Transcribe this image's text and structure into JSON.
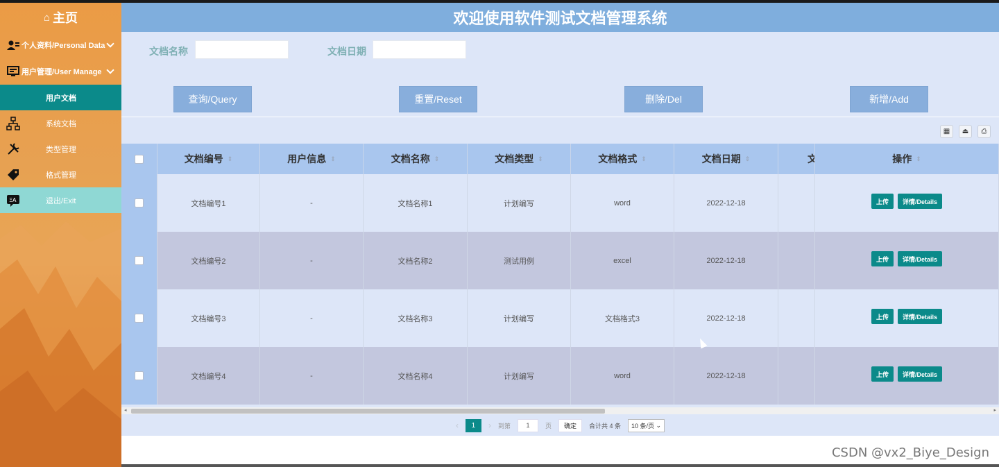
{
  "window": {
    "title": "欢迎使用软件测试文档管理系统"
  },
  "sidebar": {
    "home": "主页",
    "groups": [
      {
        "label": "个人资料/Personal Data",
        "icon": "user-card-icon"
      },
      {
        "label": "用户管理/User Manage",
        "icon": "monitor-icon"
      }
    ],
    "items": [
      {
        "label": "用户文档",
        "icon": "",
        "active": true
      },
      {
        "label": "系统文档",
        "icon": "sitemap-icon"
      },
      {
        "label": "类型管理",
        "icon": "tools-icon"
      },
      {
        "label": "格式管理",
        "icon": "tag-icon"
      },
      {
        "label": "退出/Exit",
        "icon": "translate-icon"
      }
    ]
  },
  "search": {
    "name_label": "文档名称",
    "name_value": "",
    "date_label": "文档日期",
    "date_value": ""
  },
  "actions": {
    "query": "查询/Query",
    "reset": "重置/Reset",
    "delete": "删除/Del",
    "add": "新增/Add"
  },
  "toolbar_icons": [
    "columns-icon",
    "export-icon",
    "print-icon"
  ],
  "table": {
    "headers": [
      "文档编号",
      "用户信息",
      "文档名称",
      "文档类型",
      "文档格式",
      "文档日期",
      "文",
      "操作"
    ],
    "rows": [
      {
        "id": "文档编号1",
        "user": "-",
        "name": "文档名称1",
        "type": "计划编写",
        "format": "word",
        "date": "2022-12-18"
      },
      {
        "id": "文档编号2",
        "user": "-",
        "name": "文档名称2",
        "type": "测试用例",
        "format": "excel",
        "date": "2022-12-18"
      },
      {
        "id": "文档编号3",
        "user": "-",
        "name": "文档名称3",
        "type": "计划编写",
        "format": "文档格式3",
        "date": "2022-12-18"
      },
      {
        "id": "文档编号4",
        "user": "-",
        "name": "文档名称4",
        "type": "计划编写",
        "format": "word",
        "date": "2022-12-18"
      }
    ],
    "row_actions": {
      "upload": "上传",
      "details": "详情/Details"
    }
  },
  "pagination": {
    "current": "1",
    "goto_label": "到第",
    "goto_value": "1",
    "page_unit": "页",
    "confirm": "确定",
    "total": "合计共 4 条",
    "page_size": "10 条/页"
  },
  "watermark": "CSDN @vx2_Biye_Design",
  "colors": {
    "accent": "#0b8a8a",
    "header": "#7faedd",
    "sidebar": "#eb9b45"
  }
}
